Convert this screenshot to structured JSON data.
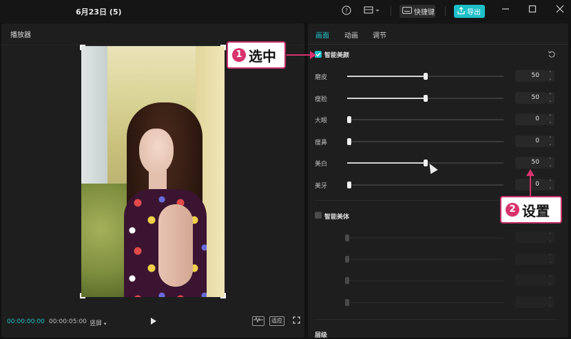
{
  "titlebar": {
    "project_title": "6月23日 (5)",
    "shortcut_label": "快捷键",
    "export_label": "导出",
    "help_icon": "help-circle-icon",
    "layout_icon": "layout-icon"
  },
  "player": {
    "title": "播放器",
    "current_time": "00:00:00:00",
    "duration": "00:00:05:00",
    "ratio_label": "竖屏",
    "fit_label": "适应",
    "wave_icon": "waveform-icon"
  },
  "inspector": {
    "tabs": [
      {
        "label": "画面",
        "active": true
      },
      {
        "label": "动画",
        "active": false
      },
      {
        "label": "调节",
        "active": false
      }
    ],
    "smart_beauty": {
      "label": "智能美颜",
      "checked": true,
      "sliders": [
        {
          "label": "磨皮",
          "value": "50",
          "level": 50
        },
        {
          "label": "瘦脸",
          "value": "50",
          "level": 50
        },
        {
          "label": "大眼",
          "value": "0",
          "level": 0
        },
        {
          "label": "瘦鼻",
          "value": "0",
          "level": 0
        },
        {
          "label": "美白",
          "value": "50",
          "level": 50
        },
        {
          "label": "美牙",
          "value": "0",
          "level": 0
        }
      ]
    },
    "smart_body": {
      "label": "智能美体",
      "checked": false
    },
    "layer_label": "层级"
  },
  "annotations": {
    "step1": {
      "number": "1",
      "text": "选中"
    },
    "step2": {
      "number": "2",
      "text": "设置"
    },
    "accent_color": "#d8336f"
  },
  "colors": {
    "accent": "#22c1c9",
    "background": "#121212",
    "panel": "#1e1e1e"
  }
}
